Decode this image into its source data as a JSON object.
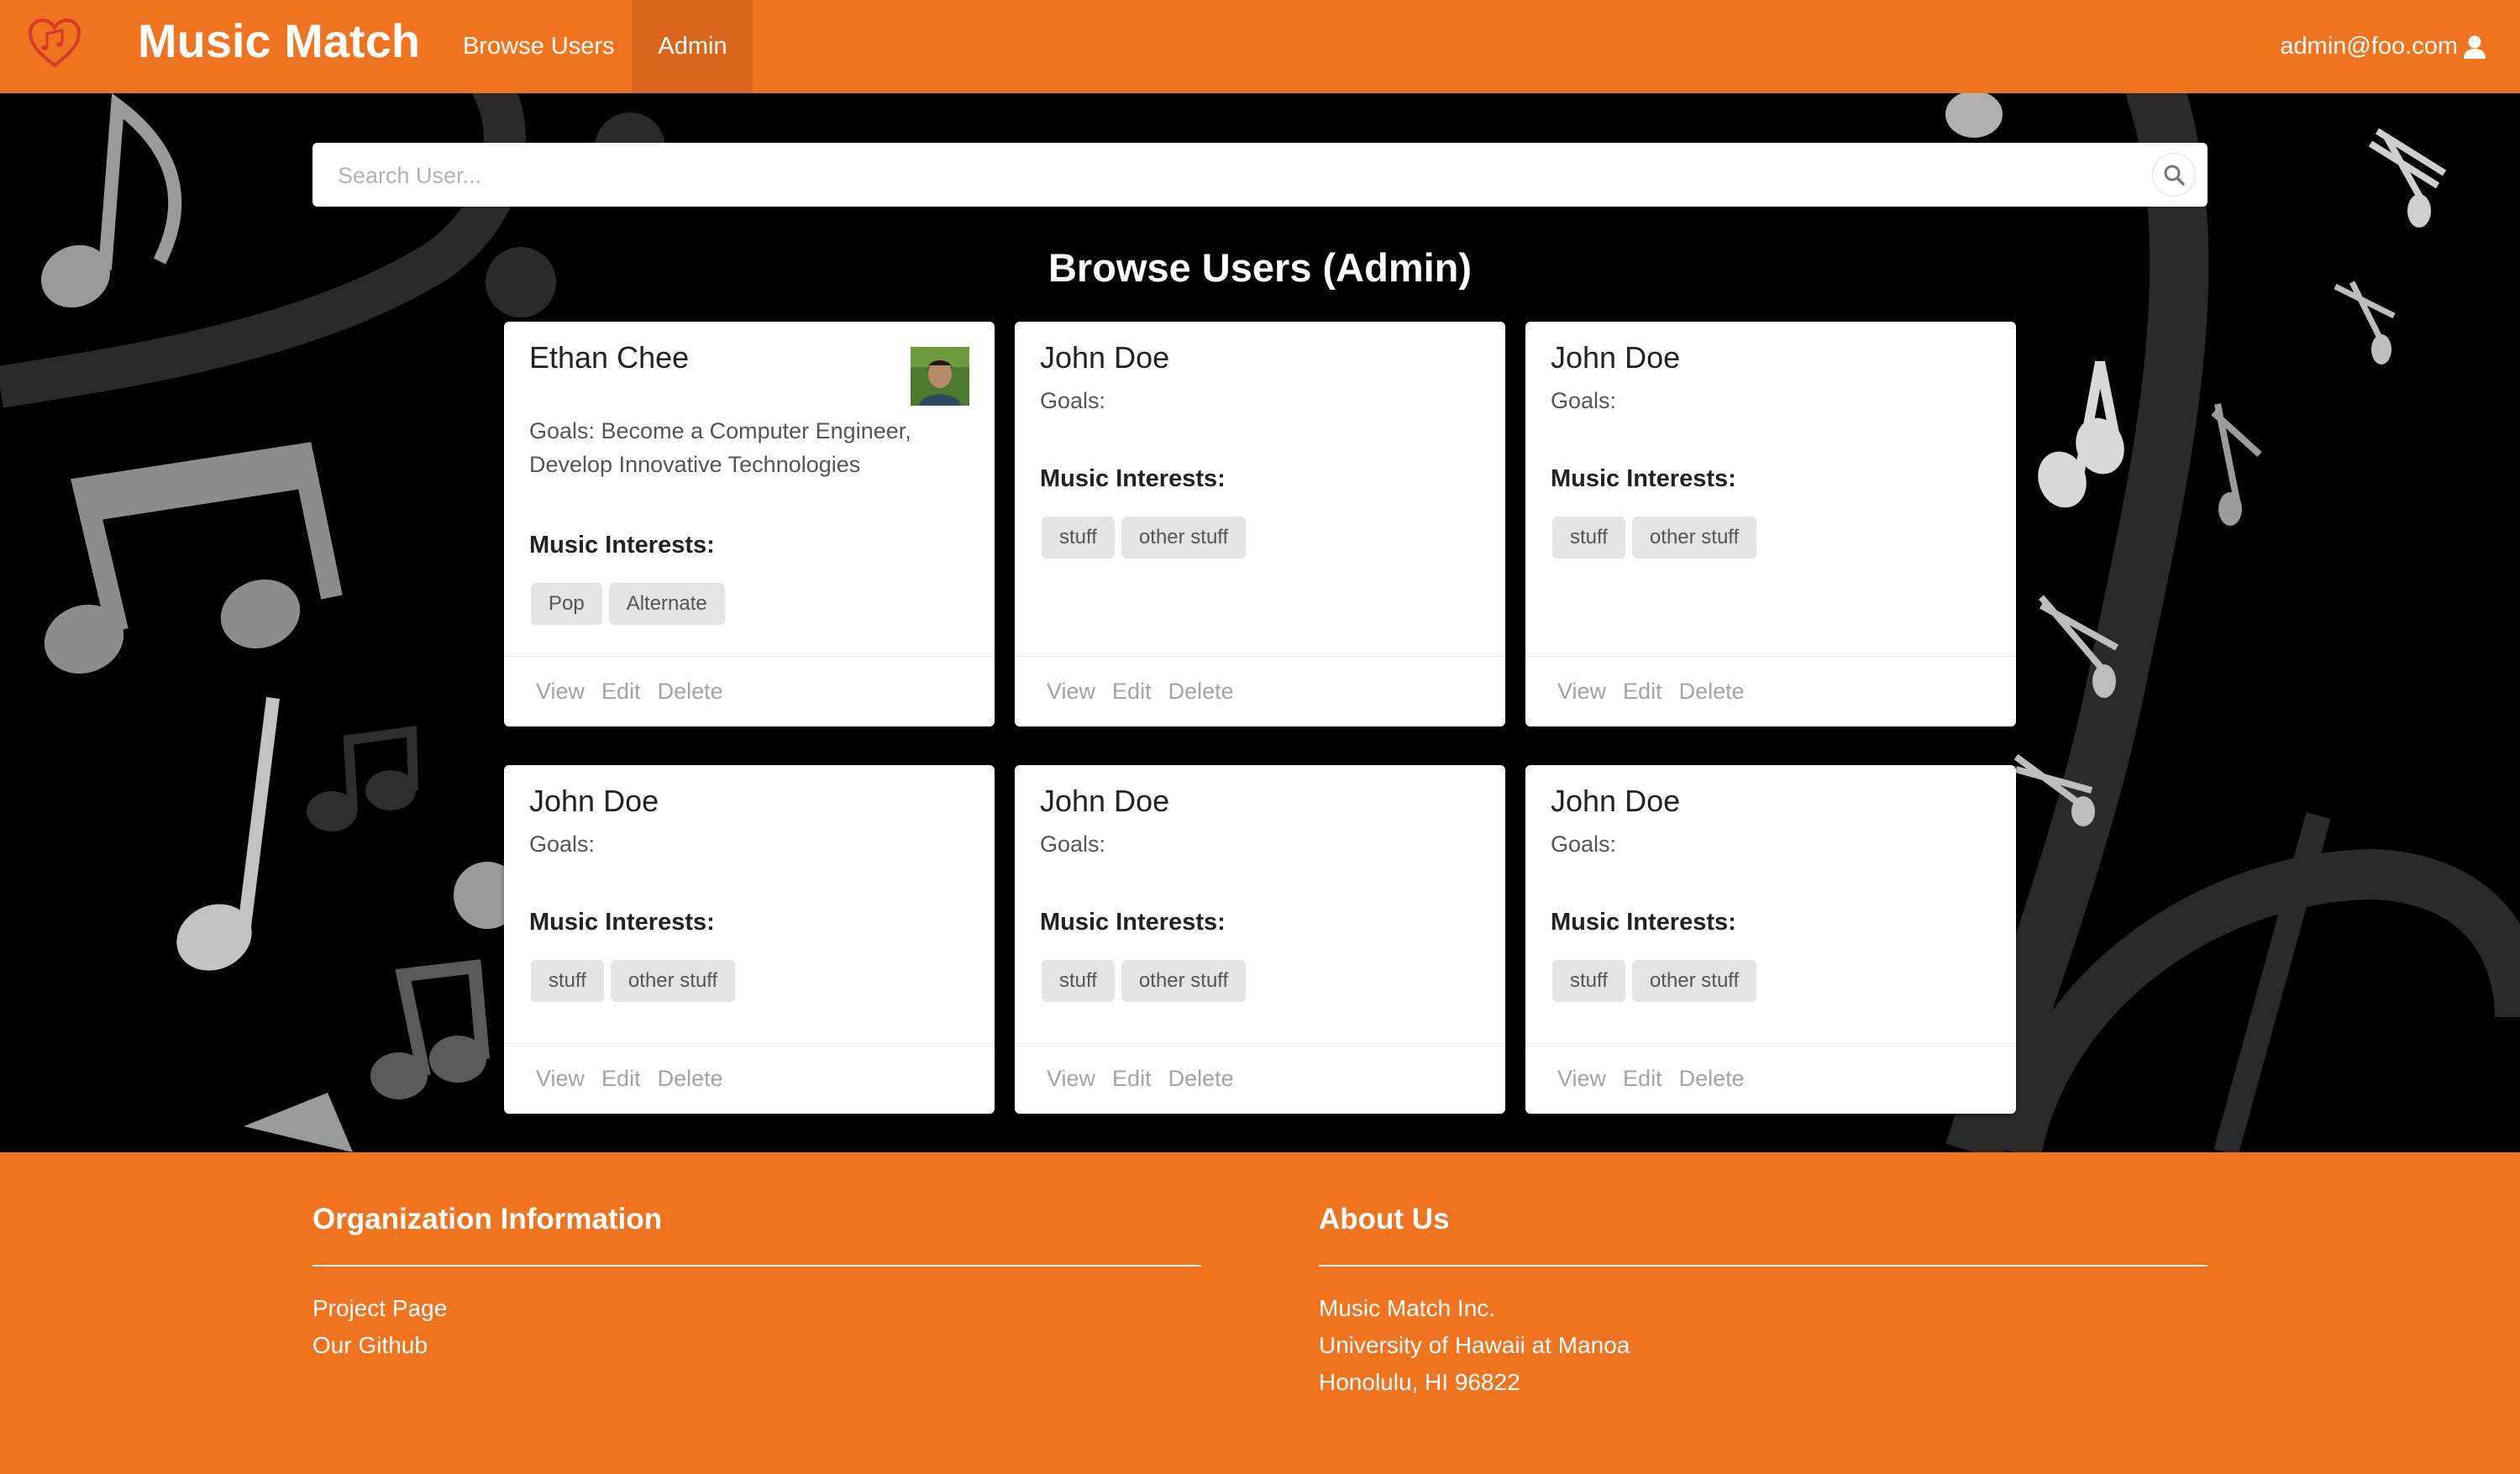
{
  "navbar": {
    "brand": "Music Match",
    "links": [
      "Browse Users",
      "Admin"
    ],
    "active": "Admin",
    "user": "admin@foo.com",
    "logo_icon": "heart-music-icon",
    "user_icon": "user-icon",
    "color": "#f07420"
  },
  "search": {
    "placeholder": "Search User...",
    "icon": "search-icon"
  },
  "page_title": "Browse Users (Admin)",
  "cards": [
    {
      "name": "Ethan Chee",
      "has_avatar": true,
      "goals": "Goals: Become a Computer Engineer, Develop Innovative Technologies",
      "interests_label": "Music Interests:",
      "interests": [
        "Pop",
        "Alternate"
      ],
      "actions": [
        "View",
        "Edit",
        "Delete"
      ]
    },
    {
      "name": "John Doe",
      "goals": "Goals:",
      "interests_label": "Music Interests:",
      "interests": [
        "stuff",
        "other stuff"
      ],
      "actions": [
        "View",
        "Edit",
        "Delete"
      ]
    },
    {
      "name": "John Doe",
      "goals": "Goals:",
      "interests_label": "Music Interests:",
      "interests": [
        "stuff",
        "other stuff"
      ],
      "actions": [
        "View",
        "Edit",
        "Delete"
      ]
    },
    {
      "name": "John Doe",
      "goals": "Goals:",
      "interests_label": "Music Interests:",
      "interests": [
        "stuff",
        "other stuff"
      ],
      "actions": [
        "View",
        "Edit",
        "Delete"
      ]
    },
    {
      "name": "John Doe",
      "goals": "Goals:",
      "interests_label": "Music Interests:",
      "interests": [
        "stuff",
        "other stuff"
      ],
      "actions": [
        "View",
        "Edit",
        "Delete"
      ]
    },
    {
      "name": "John Doe",
      "goals": "Goals:",
      "interests_label": "Music Interests:",
      "interests": [
        "stuff",
        "other stuff"
      ],
      "actions": [
        "View",
        "Edit",
        "Delete"
      ]
    }
  ],
  "footer": {
    "org": {
      "title": "Organization Information",
      "links": [
        "Project Page",
        "Our Github"
      ]
    },
    "about": {
      "title": "About Us",
      "lines": [
        "Music Match Inc.",
        "University of Hawaii at Manoa",
        "Honolulu, HI 96822"
      ]
    }
  }
}
